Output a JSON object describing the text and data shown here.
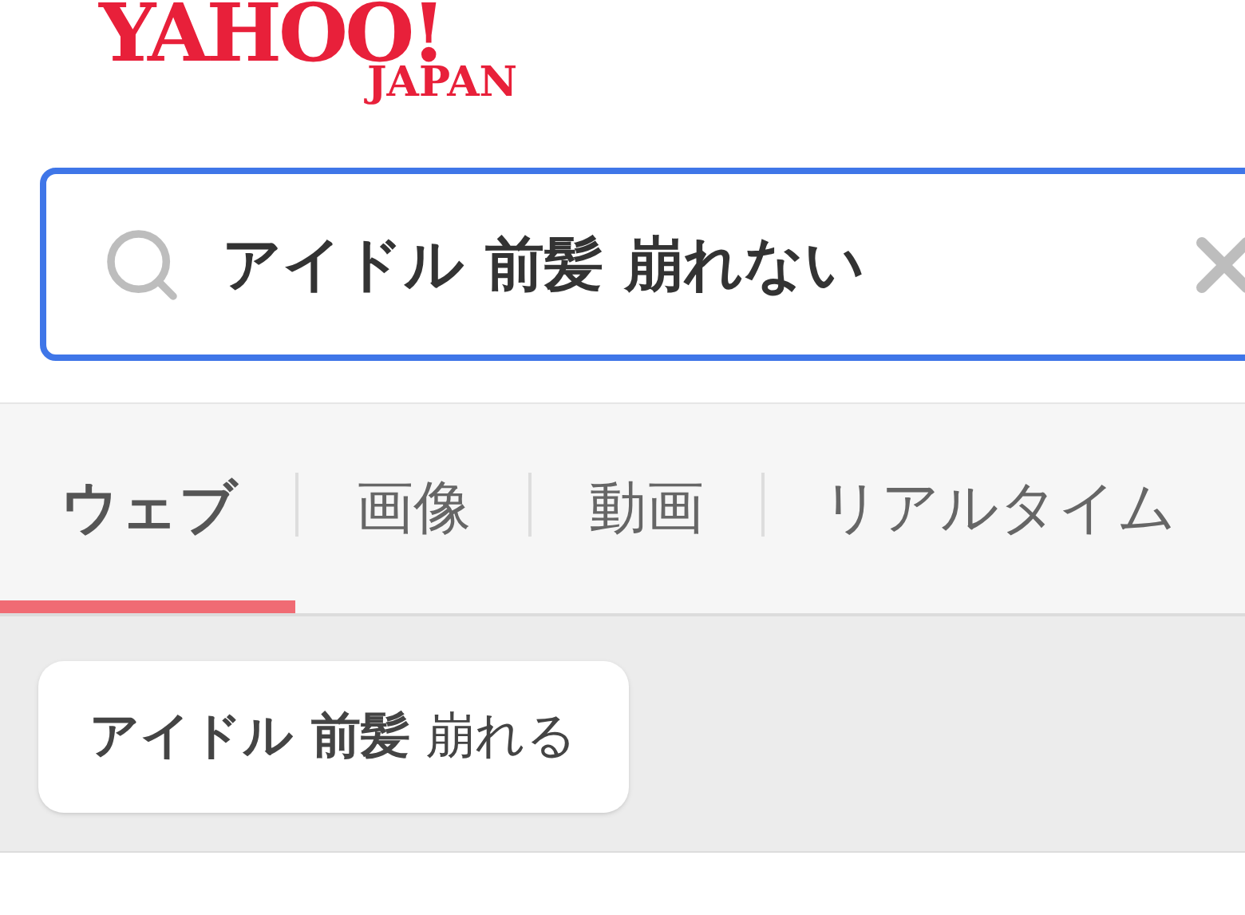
{
  "logo": {
    "wordmark": "YAHOO!",
    "subtitle": "JAPAN"
  },
  "search": {
    "value": "アイドル 前髪 崩れない"
  },
  "tabs": [
    {
      "label": "ウェブ",
      "selected": true
    },
    {
      "label": "画像",
      "selected": false
    },
    {
      "label": "動画",
      "selected": false
    },
    {
      "label": "リアルタイム",
      "selected": false
    }
  ],
  "suggestions": [
    "**アイドル 前髪** 崩れる"
  ]
}
